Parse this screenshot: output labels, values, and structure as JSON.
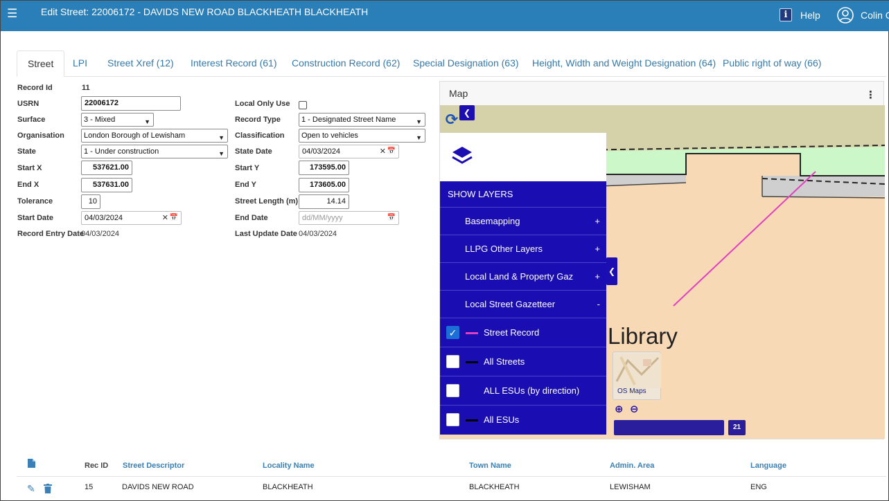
{
  "header": {
    "menu_icon": "hamburger-icon",
    "title": "Edit Street: 22006172 - DAVIDS NEW ROAD BLACKHEATH BLACKHEATH",
    "help_icon": "info-icon",
    "help_label": "Help",
    "user_icon": "user-icon",
    "user_name": "Colin C",
    "bar_color": "#2b7fb8"
  },
  "tabs": [
    {
      "label": "Street"
    },
    {
      "label": "LPI"
    },
    {
      "label": "Street Xref (12)"
    },
    {
      "label": "Interest Record (61)"
    },
    {
      "label": "Construction Record (62)"
    },
    {
      "label": "Special Designation (63)"
    },
    {
      "label": "Height, Width and Weight Designation (64)"
    },
    {
      "label": "Public right of way (66)"
    }
  ],
  "active_tab": "Street",
  "form": {
    "record_id_label": "Record Id",
    "record_id": "11",
    "usrn_label": "USRN",
    "usrn": "22006172",
    "surface_label": "Surface",
    "surface": "3 - Mixed",
    "organisation_label": "Organisation",
    "organisation": "London Borough of Lewisham",
    "state_label": "State",
    "state": "1 - Under construction",
    "start_x_label": "Start X",
    "start_x": "537621.00",
    "end_x_label": "End X",
    "end_x": "537631.00",
    "tolerance_label": "Tolerance",
    "tolerance": "10",
    "start_date_label": "Start Date",
    "start_date": "04/03/2024",
    "record_entry_date_label": "Record Entry Date",
    "record_entry_date": "04/03/2024",
    "local_only_use_label": "Local Only Use",
    "local_only_use": false,
    "record_type_label": "Record Type",
    "record_type": "1 - Designated Street Name",
    "classification_label": "Classification",
    "classification": "Open to vehicles",
    "state_date_label": "State Date",
    "state_date": "04/03/2024",
    "start_y_label": "Start Y",
    "start_y": "173595.00",
    "end_y_label": "End Y",
    "end_y": "173605.00",
    "street_length_label": "Street Length (m)",
    "street_length": "14.14",
    "end_date_label": "End Date",
    "end_date_placeholder": "dd/MM/yyyy",
    "last_update_date_label": "Last Update Date",
    "last_update_date": "04/03/2024"
  },
  "map": {
    "title": "Map",
    "show_layers": "SHOW LAYERS",
    "layer_groups": [
      {
        "label": "Basemapping",
        "toggle": "+"
      },
      {
        "label": "LLPG Other Layers",
        "toggle": "+"
      },
      {
        "label": "Local Land & Property Gaz",
        "toggle": "+"
      },
      {
        "label": "Local Street Gazetteer",
        "toggle": "-"
      }
    ],
    "layers": [
      {
        "label": "Street Record",
        "checked": true,
        "color": "#e040c0"
      },
      {
        "label": "All Streets",
        "checked": false,
        "color": "#000000"
      },
      {
        "label": "ALL ESUs (by direction)",
        "checked": false,
        "color": ""
      },
      {
        "label": "All ESUs",
        "checked": false,
        "color": "#000000"
      }
    ],
    "basemap_label": "Library",
    "os_maps_label": "OS Maps",
    "scale_badge": "21",
    "panel_color": "#1a0db2"
  },
  "table": {
    "headers": [
      "Rec ID",
      "Street Descriptor",
      "Locality Name",
      "Town Name",
      "Admin. Area",
      "Language"
    ],
    "rows": [
      {
        "rec_id": "15",
        "street_descriptor": "DAVIDS NEW ROAD",
        "locality": "BLACKHEATH",
        "town": "BLACKHEATH",
        "admin_area": "LEWISHAM",
        "language": "ENG"
      }
    ]
  }
}
